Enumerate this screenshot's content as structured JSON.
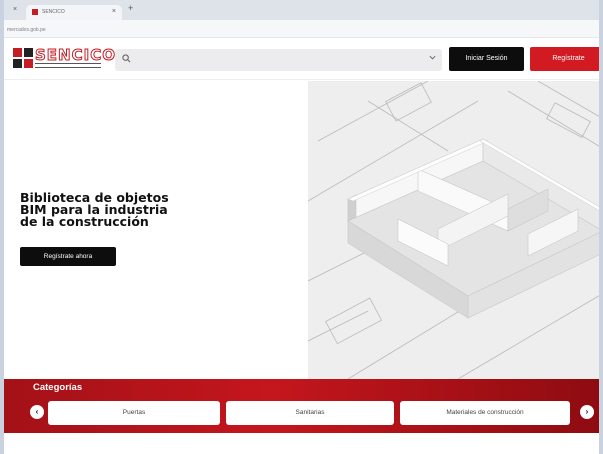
{
  "browser": {
    "tab_title": "SENCICO",
    "tab_close": "×",
    "new_tab": "+",
    "left_tab_close": "×",
    "url": "mercados.gob.pe"
  },
  "header": {
    "logo_text": "SENCICO",
    "search": {
      "placeholder": ""
    },
    "login_label": "Iniciar Sesión",
    "register_label": "Regístrate"
  },
  "hero": {
    "title_lines": [
      "Biblioteca de objetos",
      "BIM para la industria",
      "de la construcción"
    ],
    "cta_label": "Regístrate ahora"
  },
  "categories": {
    "title": "Categorías",
    "prev_label": "‹",
    "next_label": "›",
    "items": [
      "Puertas",
      "Sanitarias",
      "Materiales de construcción"
    ]
  },
  "colors": {
    "brand_red": "#d11a21",
    "dark": "#0d0d0d"
  }
}
